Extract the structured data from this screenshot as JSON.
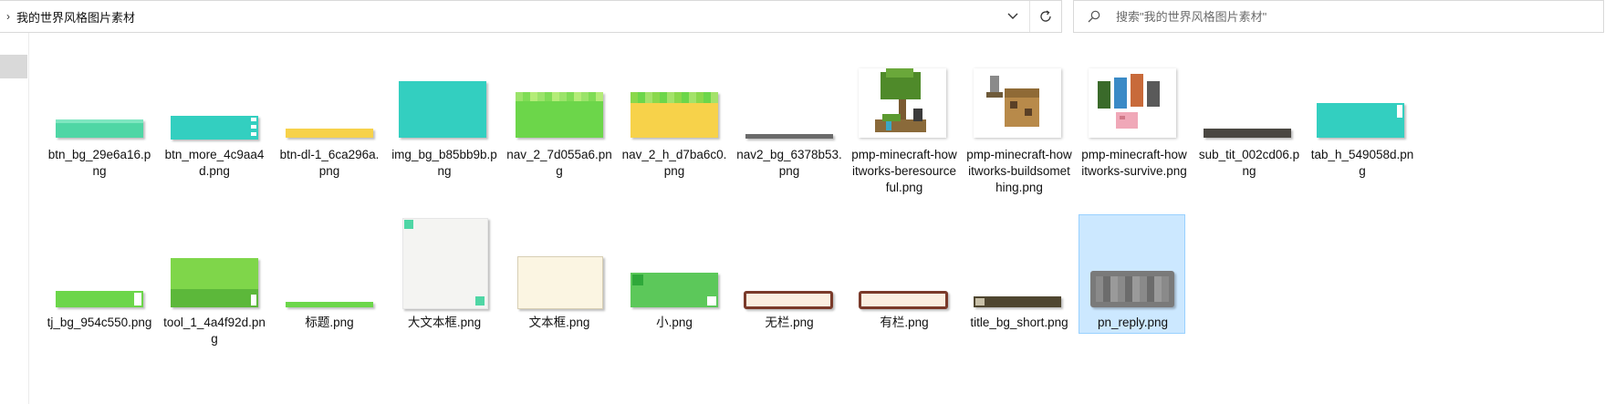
{
  "address_bar": {
    "path": "我的世界风格图片素材"
  },
  "search": {
    "placeholder": "搜索\"我的世界风格图片素材\""
  },
  "files_row1": [
    {
      "name": "btn_bg_29e6a16.png"
    },
    {
      "name": "btn_more_4c9aa4d.png"
    },
    {
      "name": "btn-dl-1_6ca296a.png"
    },
    {
      "name": "img_bg_b85bb9b.png"
    },
    {
      "name": "nav_2_7d055a6.png"
    },
    {
      "name": "nav_2_h_d7ba6c0.png"
    },
    {
      "name": "nav2_bg_6378b53.png"
    },
    {
      "name": "pmp-minecraft-howitworks-beresourceful.png"
    },
    {
      "name": "pmp-minecraft-howitworks-buildsomething.png"
    },
    {
      "name": "pmp-minecraft-howitworks-survive.png"
    },
    {
      "name": "sub_tit_002cd06.png"
    },
    {
      "name": "tab_h_549058d.png"
    }
  ],
  "files_row2": [
    {
      "name": "tj_bg_954c550.png"
    },
    {
      "name": "tool_1_4a4f92d.png"
    },
    {
      "name": "标题.png"
    },
    {
      "name": "大文本框.png"
    },
    {
      "name": "文本框.png"
    },
    {
      "name": "小.png"
    },
    {
      "name": "无栏.png"
    },
    {
      "name": "有栏.png"
    },
    {
      "name": "title_bg_short.png"
    },
    {
      "name": "pn_reply.png"
    }
  ],
  "selected_file": "pn_reply.png",
  "colors": {
    "teal": "#33cfc0",
    "mint": "#4fd6a5",
    "grass": "#6cd64a",
    "yellow": "#f7d24a",
    "selection": "#cce8ff"
  }
}
